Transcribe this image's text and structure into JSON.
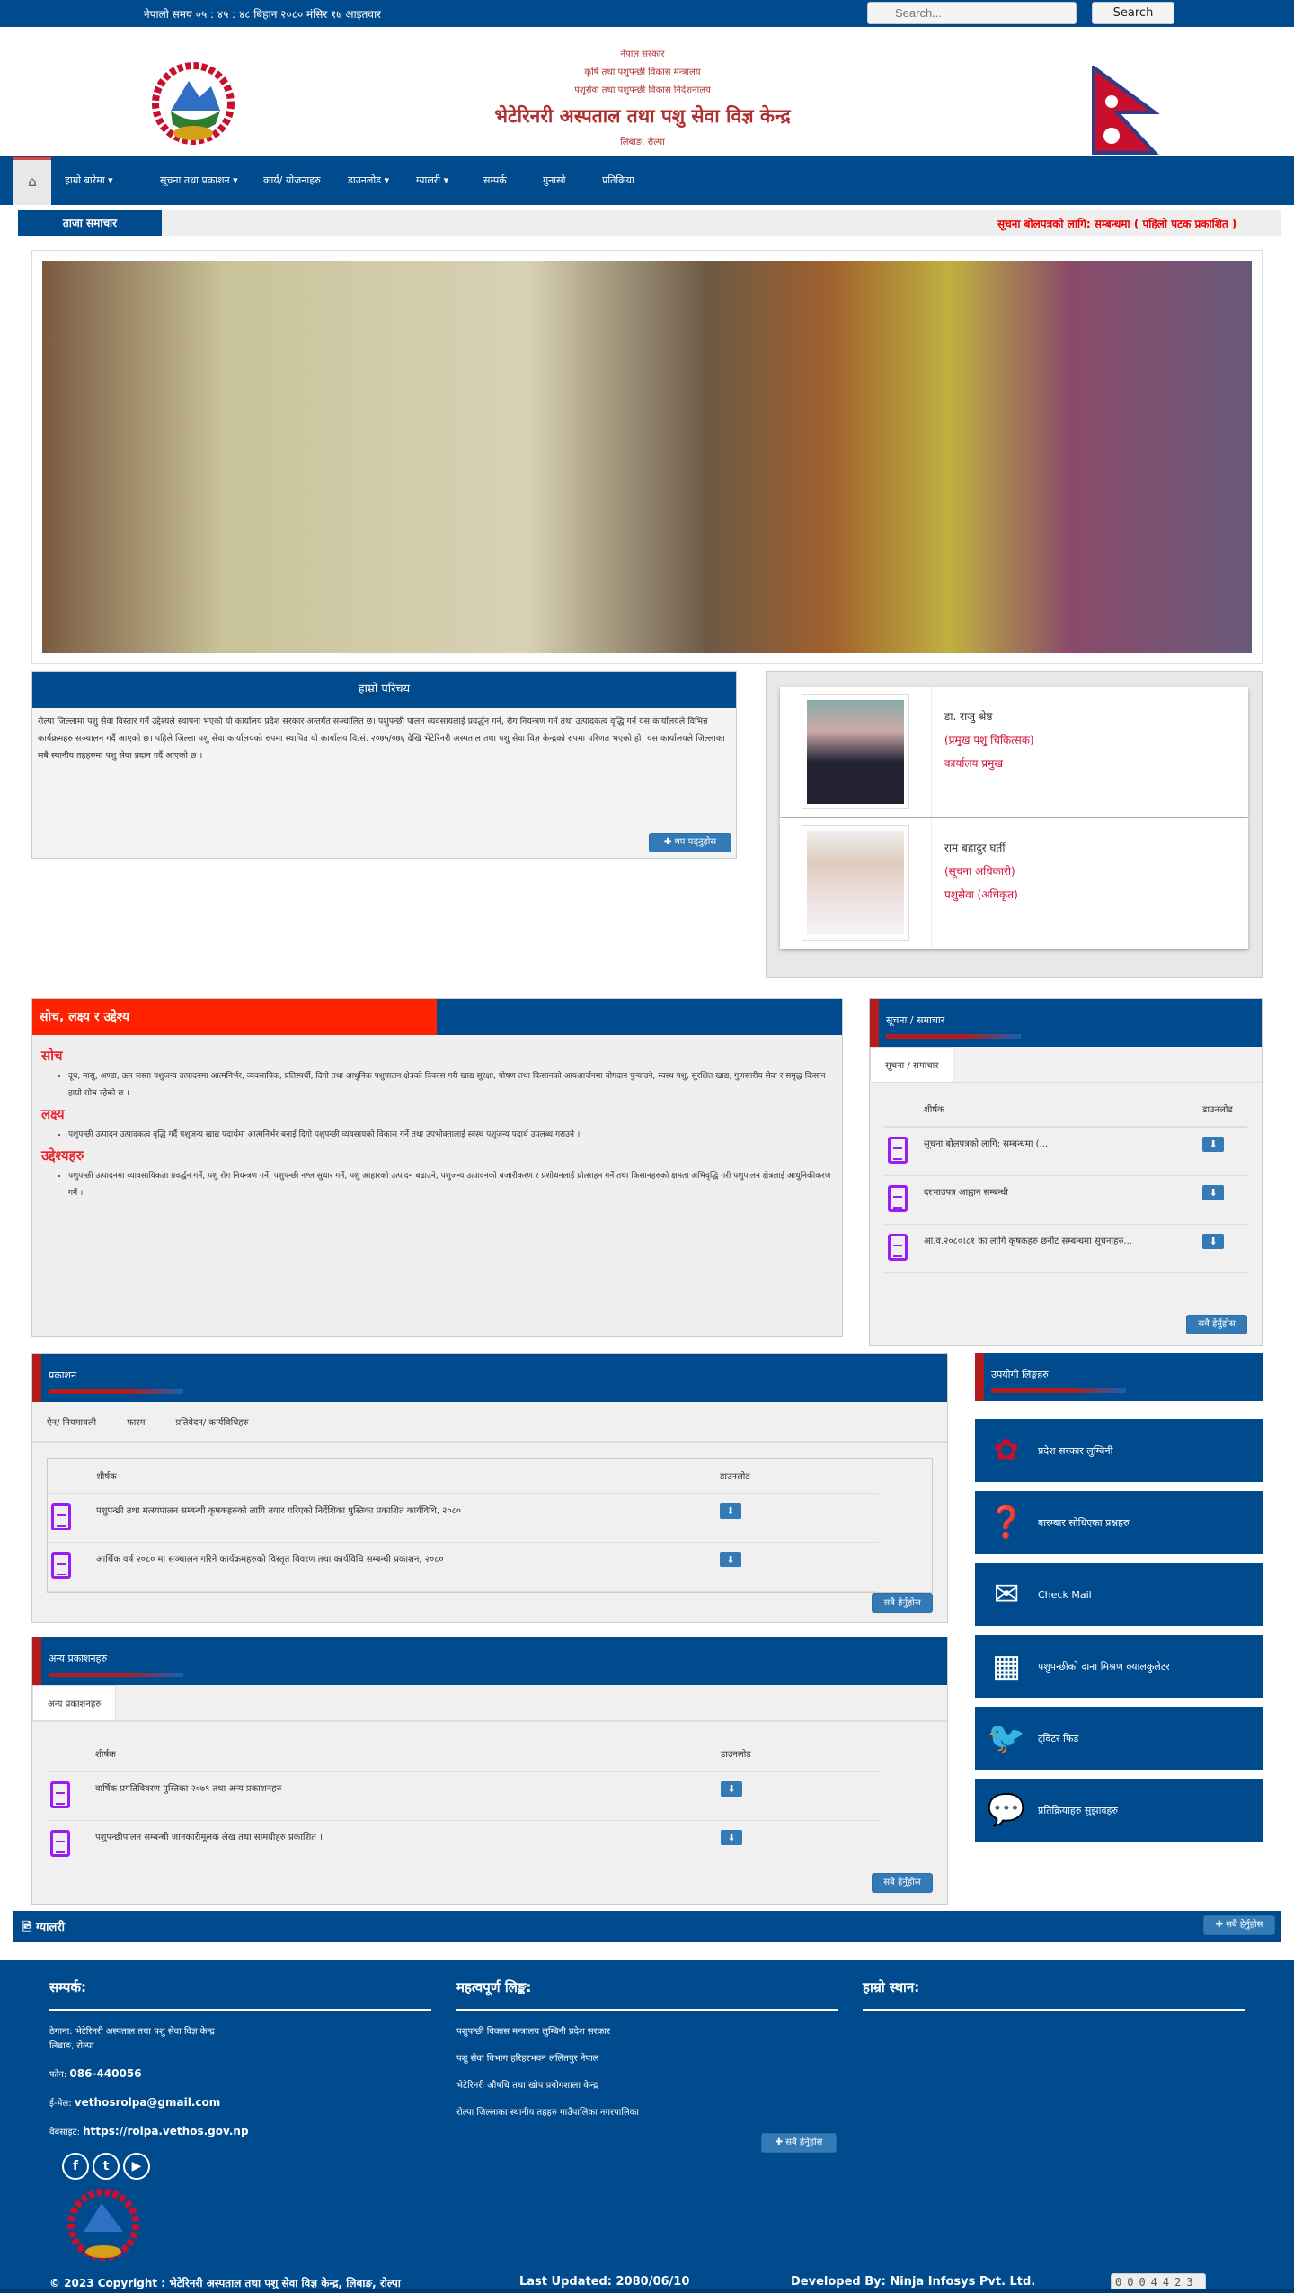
{
  "topbar": {
    "time": "नेपाली समय ०५ : ४५ : ४८ बिहान   २०८० मंसिर १७ आइतवार",
    "search_placeholder": "Search...",
    "search_button": "Search"
  },
  "header": {
    "line1": "नेपाल सरकार",
    "line2": "कृषि तथा पशुपन्छी विकास मन्त्रालय",
    "line3": "पशुसेवा तथा पशुपन्छी विकास निर्देशनालय",
    "title": "भेटेरिनरी अस्पताल तथा पशु सेवा विज्ञ केन्द्र",
    "location": "लिबाङ, रोल्पा"
  },
  "nav": {
    "home_icon": "home-icon",
    "items": [
      "हाम्रो बारेमा",
      "सूचना तथा प्रकाशन",
      "कार्य/ योजनाहरु",
      "डाउनलोड",
      "ग्यालरी",
      "सम्पर्क",
      "गुनासो",
      "प्रतिक्रिया"
    ]
  },
  "ticker": {
    "label": "ताजा समाचार",
    "text": "सूचना बोलपत्रको लागि: सम्बन्धमा ( पहिलो पटक प्रकाशित )"
  },
  "intro": {
    "title": "हाम्रो परिचय",
    "text": "रोल्पा जिल्लामा पशु सेवा विस्तार गर्ने उद्देश्यले स्थापना भएको यो कार्यालय प्रदेश सरकार अन्तर्गत सञ्चालित छ। पशुपन्छी पालन व्यवसायलाई प्रवर्द्धन गर्न, रोग नियन्त्रण गर्न तथा उत्पादकत्व वृद्धि गर्न यस कार्यालयले विभिन्न कार्यक्रमहरु सञ्चालन गर्दै आएको छ। पहिले जिल्ला पशु सेवा कार्यालयको रुपमा स्थापित यो कार्यालय वि.सं. २०७५/०७६ देखि भेटेरिनरी अस्पताल तथा पशु सेवा विज्ञ केन्द्रको रुपमा परिणत भएको हो। यस कार्यालयले जिल्लाका सबै स्थानीय तहहरुमा पशु सेवा प्रदान गर्दै आएको छ ।",
    "more": "थप पढ्नुहोस"
  },
  "staff": [
    {
      "name": "डा. राजु श्रेष्ठ",
      "role": "(प्रमुख पशु चिकित्सक)",
      "note": "कार्यालय प्रमुख"
    },
    {
      "name": "राम बहादुर घर्ती",
      "role": "(सूचना अधिकारी)",
      "note": "पशुसेवा (अधिकृत)"
    }
  ],
  "mission": {
    "title": "सोच, लक्ष्य र उद्देश्य",
    "sections": [
      {
        "heading": "सोच",
        "text": "दूध, मासु, अण्डा, ऊन जस्ता पशुजन्य उत्पादनमा आत्मनिर्भर, व्यवसायिक, प्रतिस्पर्धी, दिगो तथा आधुनिक पशुपालन क्षेत्रको विकास गरी खाद्य सुरक्षा, पोषण तथा किसानको आयआर्जनमा योगदान पुर्‍याउने, स्वस्थ पशु, सुरक्षित खाद्य, गुणस्तरीय सेवा र समृद्ध किसान हाम्रो सोच रहेको छ ।"
      },
      {
        "heading": "लक्ष्य",
        "text": "पशुपन्छी उत्पादन उत्पादकत्व वृद्धि गर्दै पशुजन्य खाद्य पदार्थमा आत्मनिर्भर बनाई दिगो पशुपन्छी व्यवसायको विकास गर्ने तथा उपभोक्तालाई स्वस्थ पशुजन्य पदार्थ उपलब्ध गराउने ।"
      },
      {
        "heading": "उद्देश्यहरु",
        "text": "पशुपन्छी उत्पादनमा व्यावसायिकता प्रवर्द्धन गर्ने, पशु रोग नियन्त्रण गर्ने, पशुपन्छी नश्ल सुधार गर्ने, पशु आहारको उत्पादन बढाउने, पशुजन्य उत्पादनको बजारीकरण र प्रशोधनलाई प्रोत्साहन गर्ने तथा किसानहरुको क्षमता अभिवृद्धि गरी पशुपालन क्षेत्रलाई आधुनिकीकरण गर्ने ।"
      }
    ]
  },
  "notices": {
    "title": "सूचना / समाचार",
    "tab": "सूचना / समाचार",
    "col_title": "शीर्षक",
    "col_download": "डाउनलोड",
    "rows": [
      "सूचना बोलपत्रको लागि: सम्बन्धमा (...",
      "दरभाउपत्र आह्वान सम्बन्धी",
      "आ.व.२०८०।८१ का लागि कृषकहरु छनौट सम्बन्धमा सूचनाहरु..."
    ],
    "more": "सबै हेर्नुहोस"
  },
  "news": {
    "title": "प्रकाशन",
    "tabs": [
      "ऐन/ नियमावली",
      "फारम",
      "प्रतिवेदन/ कार्यविधिहरु"
    ],
    "col_title": "शीर्षक",
    "col_download": "डाउनलोड",
    "rows": [
      "पशुपन्छी तथा मत्स्यपालन सम्बन्धी कृषकहरुको लागि तयार गरिएको निर्देशिका पुस्तिका प्रकाशित कार्यविधि, २०८०",
      "आर्थिक वर्ष २०८० मा सञ्चालन गरिने कार्यक्रमहरुको विस्तृत विवरण तथा कार्यविधि सम्बन्धी प्रकाशन, २०८०"
    ],
    "more": "सबै हेर्नुहोस"
  },
  "publications": {
    "title": "अन्य प्रकाशनहरु",
    "tab": "अन्य प्रकाशनहरु",
    "col_title": "शीर्षक",
    "col_download": "डाउनलोड",
    "rows": [
      "वार्षिक प्रगतिविवरण पुस्तिका २०७९ तथा अन्य प्रकाशनहरु",
      "पशुपन्छीपालन सम्बन्धी जानकारीमूलक लेख तथा सामग्रीहरु प्रकाशित ।"
    ],
    "more": "सबै हेर्नुहोस"
  },
  "links": {
    "title": "उपयोगी लिङ्कहरु",
    "items": [
      {
        "icon": "emblem-icon",
        "label": "प्रदेश सरकार लुम्बिनी"
      },
      {
        "icon": "question-icon",
        "label": "बारम्बार सोधिएका प्रश्नहरु"
      },
      {
        "icon": "mail-icon",
        "label": "Check Mail"
      },
      {
        "icon": "calculator-icon",
        "label": "पशुपन्छीको दाना मिश्रण क्यालकुलेटर"
      },
      {
        "icon": "twitter-icon",
        "label": "ट्विटर फिड"
      },
      {
        "icon": "chat-icon",
        "label": "प्रतिक्रियाहरु सुझावहरु"
      }
    ]
  },
  "gallery": {
    "title": "ग्यालरी",
    "more": "सबै हेर्नुहोस"
  },
  "footer": {
    "contact_title": "सम्पर्क:",
    "address": "ठेगाना: भेटेरिनरी अस्पताल तथा पशु सेवा विज्ञ केन्द्र",
    "address2": "लिबाङ, रोल्पा",
    "phone_label": "फोन:",
    "phone": "086-440056",
    "email_label": "ई-मेल:",
    "email": "vethosrolpa@gmail.com",
    "web_label": "वेबसाइट:",
    "web": "https://rolpa.vethos.gov.np",
    "links_title": "महत्वपूर्ण लिङ्क:",
    "links": [
      "पशुपन्छी विकास मन्त्रालय लुम्बिनी प्रदेश सरकार",
      "पशु सेवा विभाग हरिहरभवन ललितपुर नेपाल",
      "भेटेरिनरी औषधि तथा खोप प्रयोगशाला केन्द्र",
      "रोल्पा जिल्लाका स्थानीय तहहरु गाउँपालिका नगरपालिका"
    ],
    "links_more": "सबै हेर्नुहोस",
    "map_title": "हाम्रो स्थान:",
    "copyright": "© 2023 Copyright : भेटेरिनरी अस्पताल तथा पशु सेवा विज्ञ केन्द्र, लिबाङ, रोल्पा",
    "updated": "Last Updated: 2080/06/10",
    "developer": "Developed By: Ninja Infosys Pvt. Ltd.",
    "counter": "0004423"
  }
}
